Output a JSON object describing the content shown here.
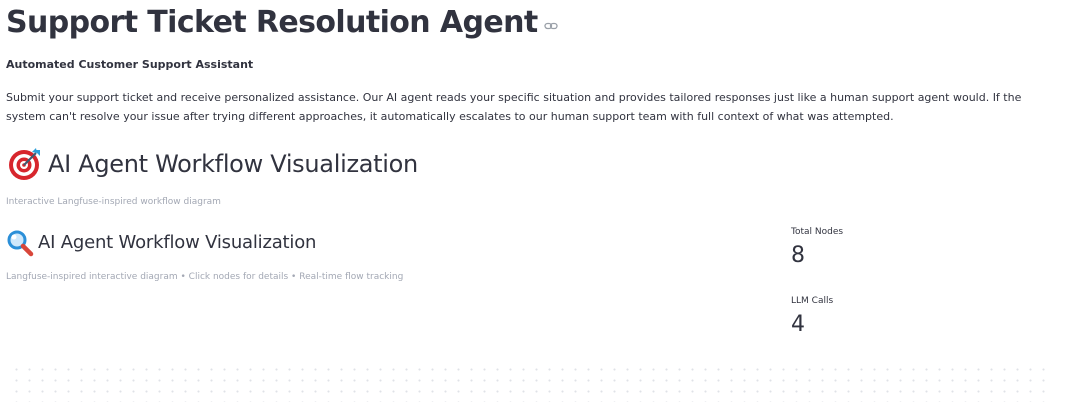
{
  "header": {
    "title": "Support Ticket Resolution Agent",
    "link_icon": "link-icon"
  },
  "intro": {
    "subtitle": "Automated Customer Support Assistant",
    "description": "Submit your support ticket and receive personalized assistance. Our AI agent reads your specific situation and provides tailored responses just like a human support agent would. If the system can't resolve your issue after trying different approaches, it automatically escalates to our human support team with full context of what was attempted."
  },
  "workflow_section": {
    "icon": "target-icon",
    "title": "AI Agent Workflow Visualization",
    "caption": "Interactive Langfuse-inspired workflow diagram"
  },
  "diagram_panel": {
    "icon": "magnifier-icon",
    "title": "AI Agent Workflow Visualization",
    "caption": "Langfuse-inspired interactive diagram • Click nodes for details • Real-time flow tracking"
  },
  "metrics": [
    {
      "label": "Total Nodes",
      "value": "8"
    },
    {
      "label": "LLM Calls",
      "value": "4"
    }
  ]
}
